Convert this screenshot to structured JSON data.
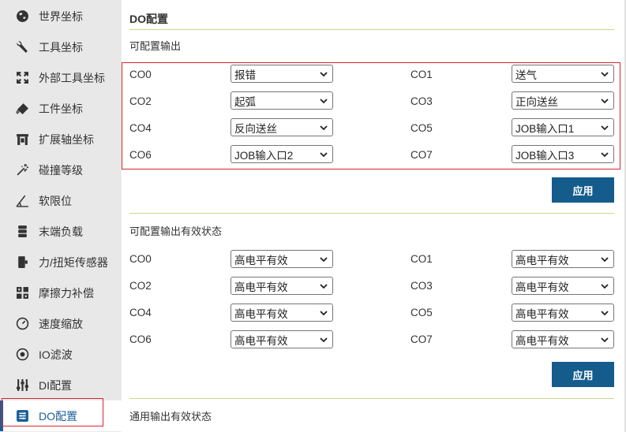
{
  "sidebar": {
    "items": [
      {
        "label": "世界坐标",
        "icon": "globe-icon"
      },
      {
        "label": "工具坐标",
        "icon": "wrench-icon"
      },
      {
        "label": "外部工具坐标",
        "icon": "expand-arrows-icon"
      },
      {
        "label": "工件坐标",
        "icon": "eraser-icon"
      },
      {
        "label": "扩展轴坐标",
        "icon": "rail-icon"
      },
      {
        "label": "碰撞等级",
        "icon": "magic-wand-icon"
      },
      {
        "label": "软限位",
        "icon": "angle-icon"
      },
      {
        "label": "末端负载",
        "icon": "server-icon"
      },
      {
        "label": "力/扭矩传感器",
        "icon": "sensor-icon"
      },
      {
        "label": "摩擦力补偿",
        "icon": "grid-icon"
      },
      {
        "label": "速度缩放",
        "icon": "speedometer-icon"
      },
      {
        "label": "IO滤波",
        "icon": "filter-dial-icon"
      },
      {
        "label": "DI配置",
        "icon": "sliders-icon"
      },
      {
        "label": "DO配置",
        "icon": "settings-panel-icon",
        "active": true
      }
    ]
  },
  "main": {
    "title": "DO配置",
    "section1": {
      "title": "可配置输出",
      "rows": [
        {
          "l_label": "CO0",
          "l_value": "报错",
          "r_label": "CO1",
          "r_value": "送气"
        },
        {
          "l_label": "CO2",
          "l_value": "起弧",
          "r_label": "CO3",
          "r_value": "正向送丝"
        },
        {
          "l_label": "CO4",
          "l_value": "反向送丝",
          "r_label": "CO5",
          "r_value": "JOB输入口1"
        },
        {
          "l_label": "CO6",
          "l_value": "JOB输入口2",
          "r_label": "CO7",
          "r_value": "JOB输入口3"
        }
      ],
      "apply": "应用"
    },
    "section2": {
      "title": "可配置输出有效状态",
      "rows": [
        {
          "l_label": "CO0",
          "l_value": "高电平有效",
          "r_label": "CO1",
          "r_value": "高电平有效"
        },
        {
          "l_label": "CO2",
          "l_value": "高电平有效",
          "r_label": "CO3",
          "r_value": "高电平有效"
        },
        {
          "l_label": "CO4",
          "l_value": "高电平有效",
          "r_label": "CO5",
          "r_value": "高电平有效"
        },
        {
          "l_label": "CO6",
          "l_value": "高电平有效",
          "r_label": "CO7",
          "r_value": "高电平有效"
        }
      ],
      "apply": "应用"
    },
    "section3": {
      "title": "通用输出有效状态"
    }
  },
  "colors": {
    "accent": "#135c8c",
    "highlight": "#d9262b",
    "divider": "#c8d88e"
  }
}
